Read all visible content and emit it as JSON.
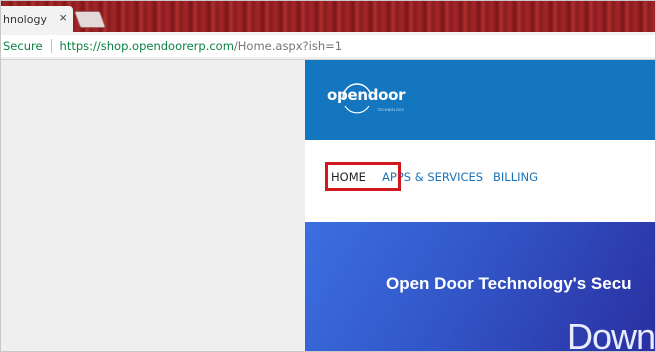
{
  "browser": {
    "tab": {
      "title": "hnology",
      "close_glyph": "×"
    },
    "address": {
      "secure_label": "Secure",
      "url_host": "https://shop.opendoorerp.com",
      "url_path": "/Home.aspx?ish=1"
    }
  },
  "site": {
    "logo": {
      "text": "opendoor",
      "tagline": "TECHNOLOGY"
    },
    "nav": {
      "home": "HOME",
      "apps": "APPS & SERVICES",
      "billing": "BILLING"
    },
    "hero": {
      "title": "Open Door Technology's Secu",
      "subtitle": "Down"
    }
  },
  "colors": {
    "header_blue": "#1376bf",
    "highlight_red": "#d0161f",
    "secure_green": "#0b8043"
  }
}
